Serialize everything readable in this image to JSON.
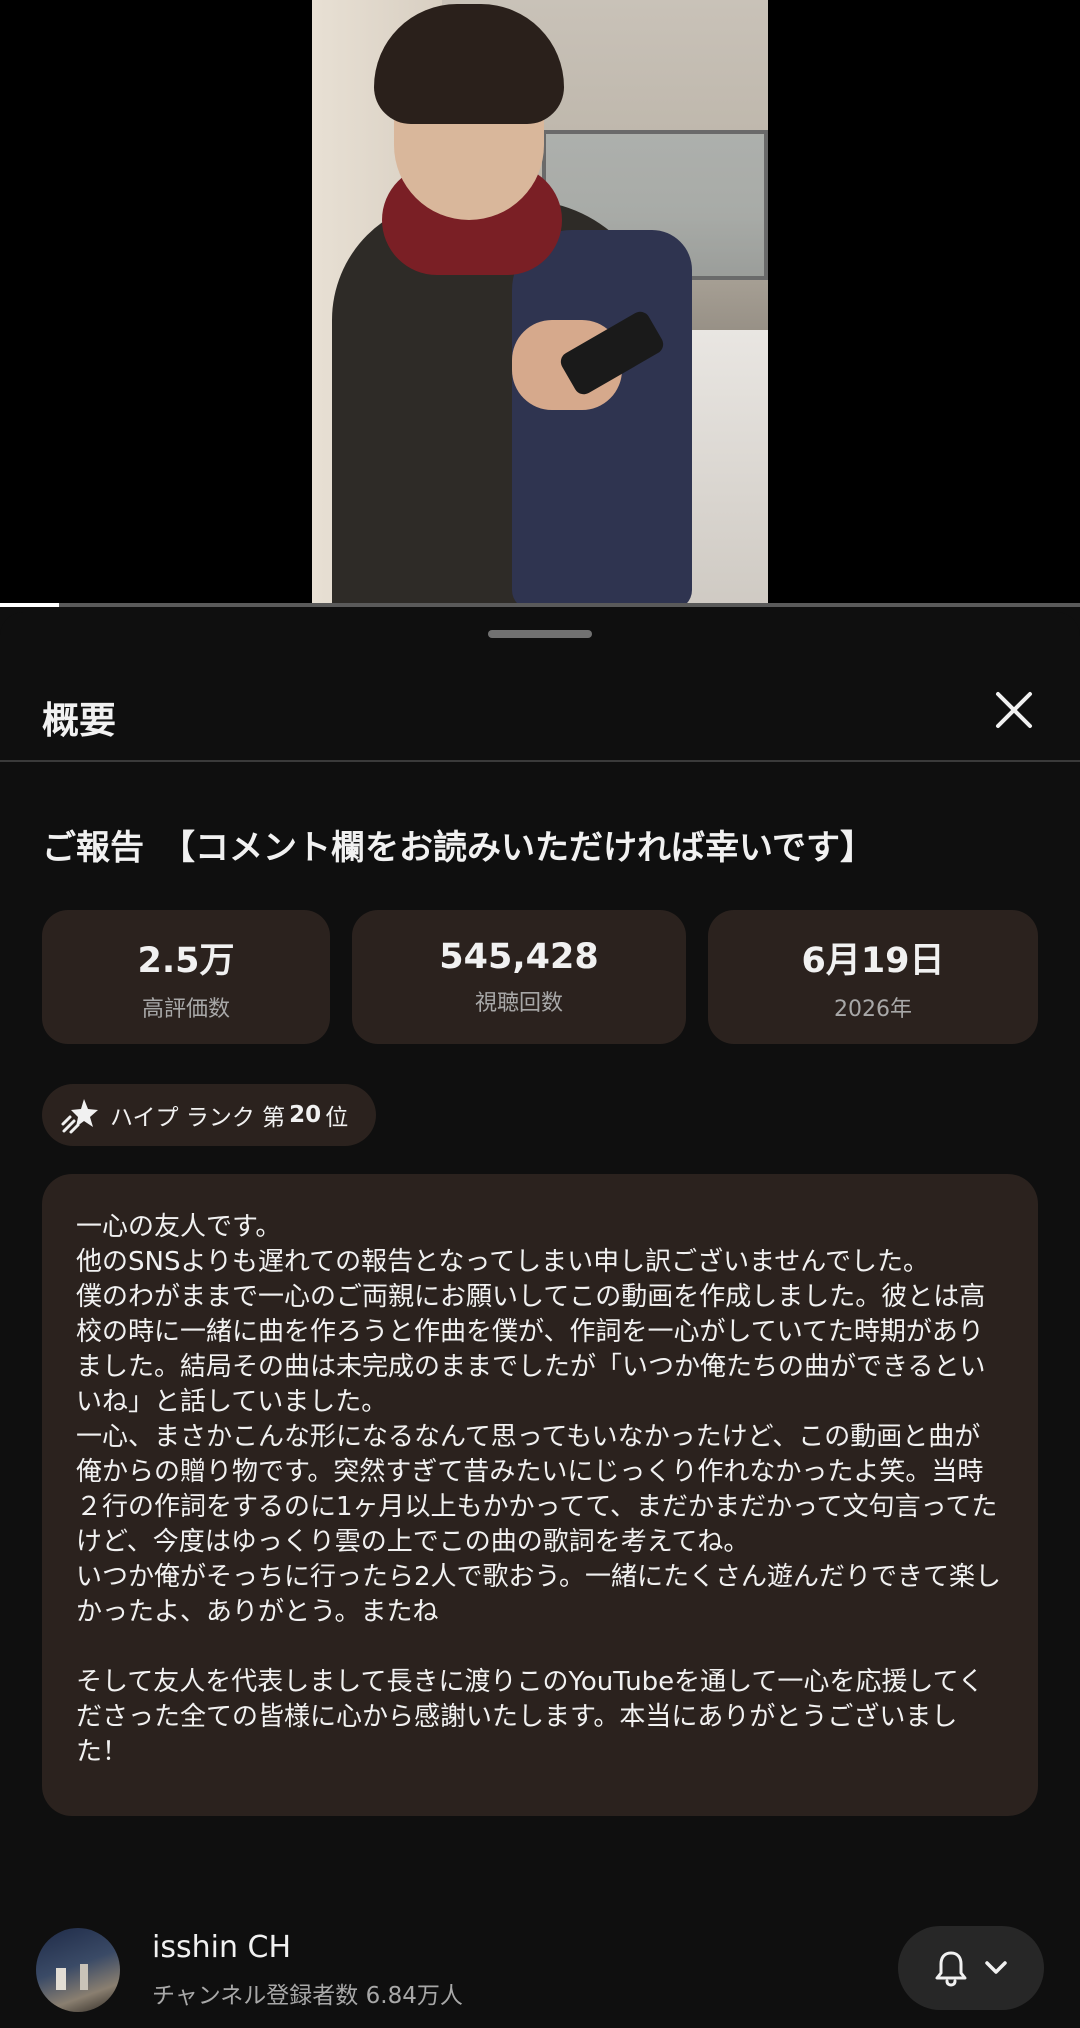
{
  "player": {
    "progress_fraction": 0.055
  },
  "panel": {
    "title": "概要",
    "close_icon": "close-icon"
  },
  "video": {
    "title": "ご報告　【コメント欄をお読みいただければ幸いです】"
  },
  "stats": {
    "likes_value": "2.5万",
    "likes_label": "高評価数",
    "views_value": "545,428",
    "views_label": "視聴回数",
    "date_value": "6月19日",
    "date_label": "2026年"
  },
  "hype": {
    "prefix": "ハイプ ランク 第",
    "rank": "20",
    "suffix": "位",
    "icon": "hype-rocket-icon"
  },
  "description": {
    "text": "一心の友人です。\n他のSNSよりも遅れての報告となってしまい申し訳ございませんでした。\n僕のわがままで一心のご両親にお願いしてこの動画を作成しました。彼とは高校の時に一緒に曲を作ろうと作曲を僕が、作詞を一心がしていてた時期がありました。結局その曲は未完成のままでしたが「いつか俺たちの曲ができるといいね」と話していました。\n一心、まさかこんな形になるなんて思ってもいなかったけど、この動画と曲が俺からの贈り物です。突然すぎて昔みたいにじっくり作れなかったよ笑。当時２行の作詞をするのに1ヶ月以上もかかってて、まだかまだかって文句言ってたけど、今度はゆっくり雲の上でこの曲の歌詞を考えてね。\nいつか俺がそっちに行ったら2人で歌おう。一緒にたくさん遊んだりできて楽しかったよ、ありがとう。またね\n\nそして友人を代表しまして長きに渡りこのYouTubeを通して一心を応援してくださった全ての皆様に心から感謝いたします。本当にありがとうございました！"
  },
  "channel": {
    "name": "isshin CH",
    "subscribers": "チャンネル登録者数 6.84万人",
    "bell_icon": "bell-icon",
    "chevron_icon": "chevron-down-icon"
  },
  "colors": {
    "background": "#0f0f0f",
    "card": "#2b221e",
    "text_primary": "#f1f1f1",
    "text_secondary": "#a8a8a8"
  }
}
